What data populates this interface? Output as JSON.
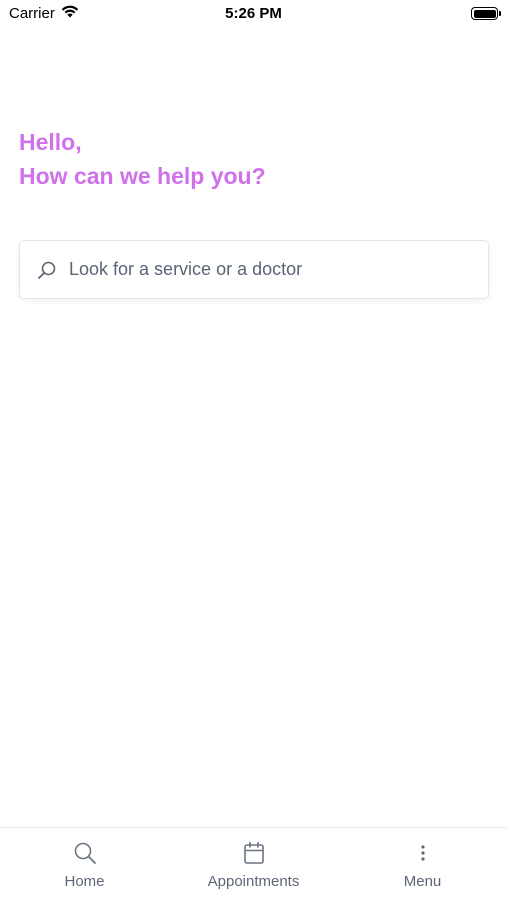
{
  "status_bar": {
    "carrier": "Carrier",
    "time": "5:26 PM",
    "wifi_icon": "wifi-icon",
    "battery_icon": "battery-icon",
    "battery_level": 1.0
  },
  "greeting": {
    "line1": "Hello,",
    "line2": "How can we help you?",
    "color": "#d070ea"
  },
  "search": {
    "icon": "search-icon",
    "placeholder": "Look for a service or a doctor",
    "value": ""
  },
  "tab_bar": {
    "items": [
      {
        "label": "Home",
        "icon": "search-icon"
      },
      {
        "label": "Appointments",
        "icon": "calendar-icon"
      },
      {
        "label": "Menu",
        "icon": "more-vertical-icon"
      }
    ]
  }
}
